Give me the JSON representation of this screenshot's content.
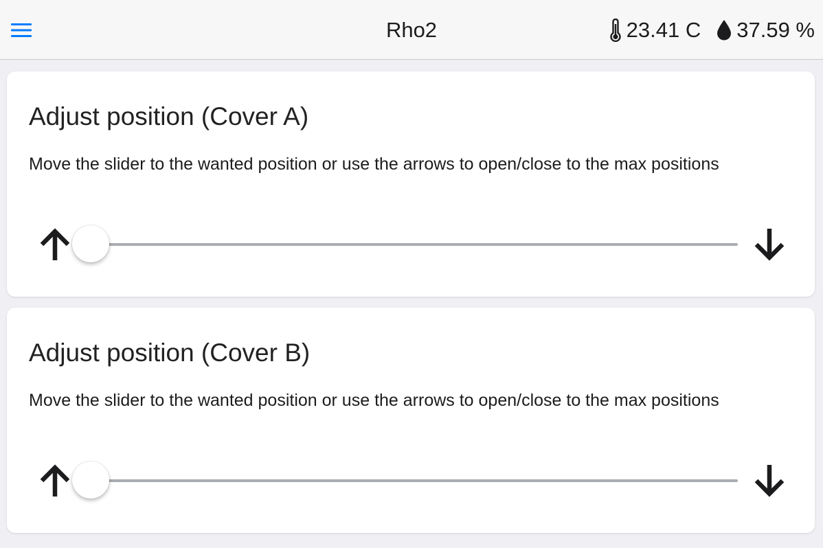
{
  "header": {
    "title": "Rho2",
    "temperature": "23.41 C",
    "humidity": "37.59 %"
  },
  "colors": {
    "accent": "#007aff",
    "background": "#efeff4",
    "card": "#ffffff",
    "track": "#a9acaf"
  },
  "icons": {
    "menu": "menu-icon",
    "temperature": "thermometer-icon",
    "humidity": "water-drop-icon",
    "open": "arrow-up-icon",
    "close": "arrow-down-icon"
  },
  "covers": [
    {
      "title": "Adjust position (Cover A)",
      "description": "Move the slider to the wanted position or use the arrows to open/close to the max positions",
      "position": 0
    },
    {
      "title": "Adjust position (Cover B)",
      "description": "Move the slider to the wanted position or use the arrows to open/close to the max positions",
      "position": 0
    }
  ]
}
